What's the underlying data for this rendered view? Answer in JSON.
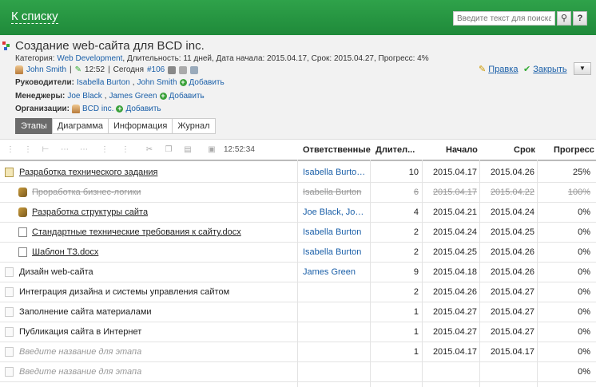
{
  "topbar": {
    "back_label": "К списку",
    "search_placeholder": "Введите текст для поиска",
    "help_label": "?"
  },
  "project": {
    "title": "Создание web-сайта для BCD inc.",
    "meta_prefix": "Категория:",
    "category": "Web Development",
    "meta_rest": ", Длительность: 11 дней, Дата начала: 2015.04.17, Срок: 2015.04.27, Прогресс: 4%",
    "owner": "John Smith",
    "time": "12:52",
    "today_label": "Сегодня",
    "number": "#106",
    "leaders_label": "Руководители:",
    "leaders": [
      "Isabella Burton",
      "John Smith"
    ],
    "managers_label": "Менеджеры:",
    "managers": [
      "Joe Black",
      "James Green"
    ],
    "orgs_label": "Организации:",
    "org": "BCD inc.",
    "add_label": "Добавить",
    "edit_label": "Правка",
    "close_label": "Закрыть"
  },
  "tabs": [
    "Этапы",
    "Диаграмма",
    "Информация",
    "Журнал"
  ],
  "toolbar": {
    "time": "12:52:34"
  },
  "columns": {
    "resp": "Ответственные",
    "dur": "Длител...",
    "start": "Начало",
    "end": "Срок",
    "prog": "Прогресс"
  },
  "rows": [
    {
      "name": "Разработка технического задания",
      "resp": "Isabella Burton,...",
      "dur": "10",
      "start": "2015.04.17",
      "end": "2015.04.26",
      "prog": "25%"
    },
    {
      "name": "Проработка бизнес-логики",
      "resp": "Isabella Burton",
      "dur": "6",
      "start": "2015.04.17",
      "end": "2015.04.22",
      "prog": "100%"
    },
    {
      "name": "Разработка структуры сайта",
      "resp": "Joe Black, John...",
      "dur": "4",
      "start": "2015.04.21",
      "end": "2015.04.24",
      "prog": "0%"
    },
    {
      "name": "Стандартные технические требования к сайту.docx",
      "resp": "Isabella Burton",
      "dur": "2",
      "start": "2015.04.24",
      "end": "2015.04.25",
      "prog": "0%"
    },
    {
      "name": "Шаблон ТЗ.docx",
      "resp": "Isabella Burton",
      "dur": "2",
      "start": "2015.04.25",
      "end": "2015.04.26",
      "prog": "0%"
    },
    {
      "name": "Дизайн web-сайта",
      "resp": "James Green",
      "dur": "9",
      "start": "2015.04.18",
      "end": "2015.04.26",
      "prog": "0%"
    },
    {
      "name": "Интеграция дизайна и системы управления сайтом",
      "resp": "",
      "dur": "2",
      "start": "2015.04.26",
      "end": "2015.04.27",
      "prog": "0%"
    },
    {
      "name": "Заполнение сайта материалами",
      "resp": "",
      "dur": "1",
      "start": "2015.04.27",
      "end": "2015.04.27",
      "prog": "0%"
    },
    {
      "name": "Публикация сайта в Интернет",
      "resp": "",
      "dur": "1",
      "start": "2015.04.27",
      "end": "2015.04.27",
      "prog": "0%"
    },
    {
      "name": "Введите название для этапа",
      "resp": "",
      "dur": "1",
      "start": "2015.04.17",
      "end": "2015.04.17",
      "prog": "0%"
    },
    {
      "name": "Введите название для этапа",
      "resp": "",
      "dur": "",
      "start": "",
      "end": "",
      "prog": "0%"
    }
  ]
}
